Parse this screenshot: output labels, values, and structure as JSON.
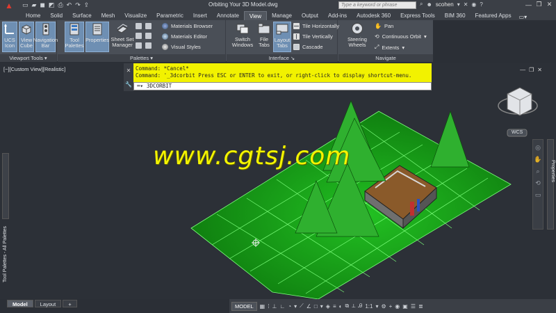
{
  "titlebar": {
    "app_icon": "autocad-a-icon",
    "doc_title": "Orbiting Your 3D Model.dwg",
    "search_placeholder": "Type a keyword or phrase",
    "user": "scohen",
    "qat_icons": [
      "new-icon",
      "open-icon",
      "save-icon",
      "save-as-icon",
      "print-icon",
      "undo-icon",
      "redo-icon",
      "share-icon"
    ]
  },
  "ribbon": {
    "tabs": [
      "Home",
      "Solid",
      "Surface",
      "Mesh",
      "Visualize",
      "Parametric",
      "Insert",
      "Annotate",
      "View",
      "Manage",
      "Output",
      "Add-ins",
      "Autodesk 360",
      "Express Tools",
      "BIM 360",
      "Featured Apps"
    ],
    "active_tab": "View",
    "panels": {
      "viewport_tools": {
        "title": "Viewport Tools",
        "buttons": [
          "UCS Icon",
          "View Cube",
          "Navigation Bar"
        ]
      },
      "palettes": {
        "title": "Palettes",
        "buttons": [
          "Tool Palettes",
          "Properties",
          "Sheet Set Manager"
        ],
        "small": [
          "Materials Browser",
          "Materials Editor",
          "Visual Styles"
        ]
      },
      "interface": {
        "title": "Interface",
        "buttons": [
          "Switch Windows",
          "File Tabs",
          "Layout Tabs"
        ],
        "small": [
          "Tile Horizontally",
          "Tile Vertically",
          "Cascade"
        ]
      },
      "navigate": {
        "title": "Navigate",
        "buttons": [
          "Steering Wheels"
        ],
        "small": [
          "Pan",
          "Continuous Orbit",
          "Extents"
        ]
      }
    }
  },
  "viewport": {
    "label": "[−][Custom View][Realistic]",
    "wcs": "WCS"
  },
  "command": {
    "history_1": "Command: *Cancel*",
    "history_2": "Command: '_3dcorbit Press ESC or ENTER to exit, or right-click to display shortcut-menu.",
    "current": "3DCORBIT"
  },
  "palettes": {
    "tool_palettes": "Tool Palettes - All Palettes",
    "properties": "Properties"
  },
  "watermark": "www.cgtsj.com",
  "layout_tabs": [
    "Model",
    "Layout",
    "+"
  ],
  "status": {
    "model": "MODEL",
    "scale": "1:1"
  },
  "colors": {
    "ribbon_bg": "#4a4f57",
    "canvas_bg": "#2c3037",
    "command_yellow": "#f2f200",
    "terrain_green": "#1aa01a"
  }
}
